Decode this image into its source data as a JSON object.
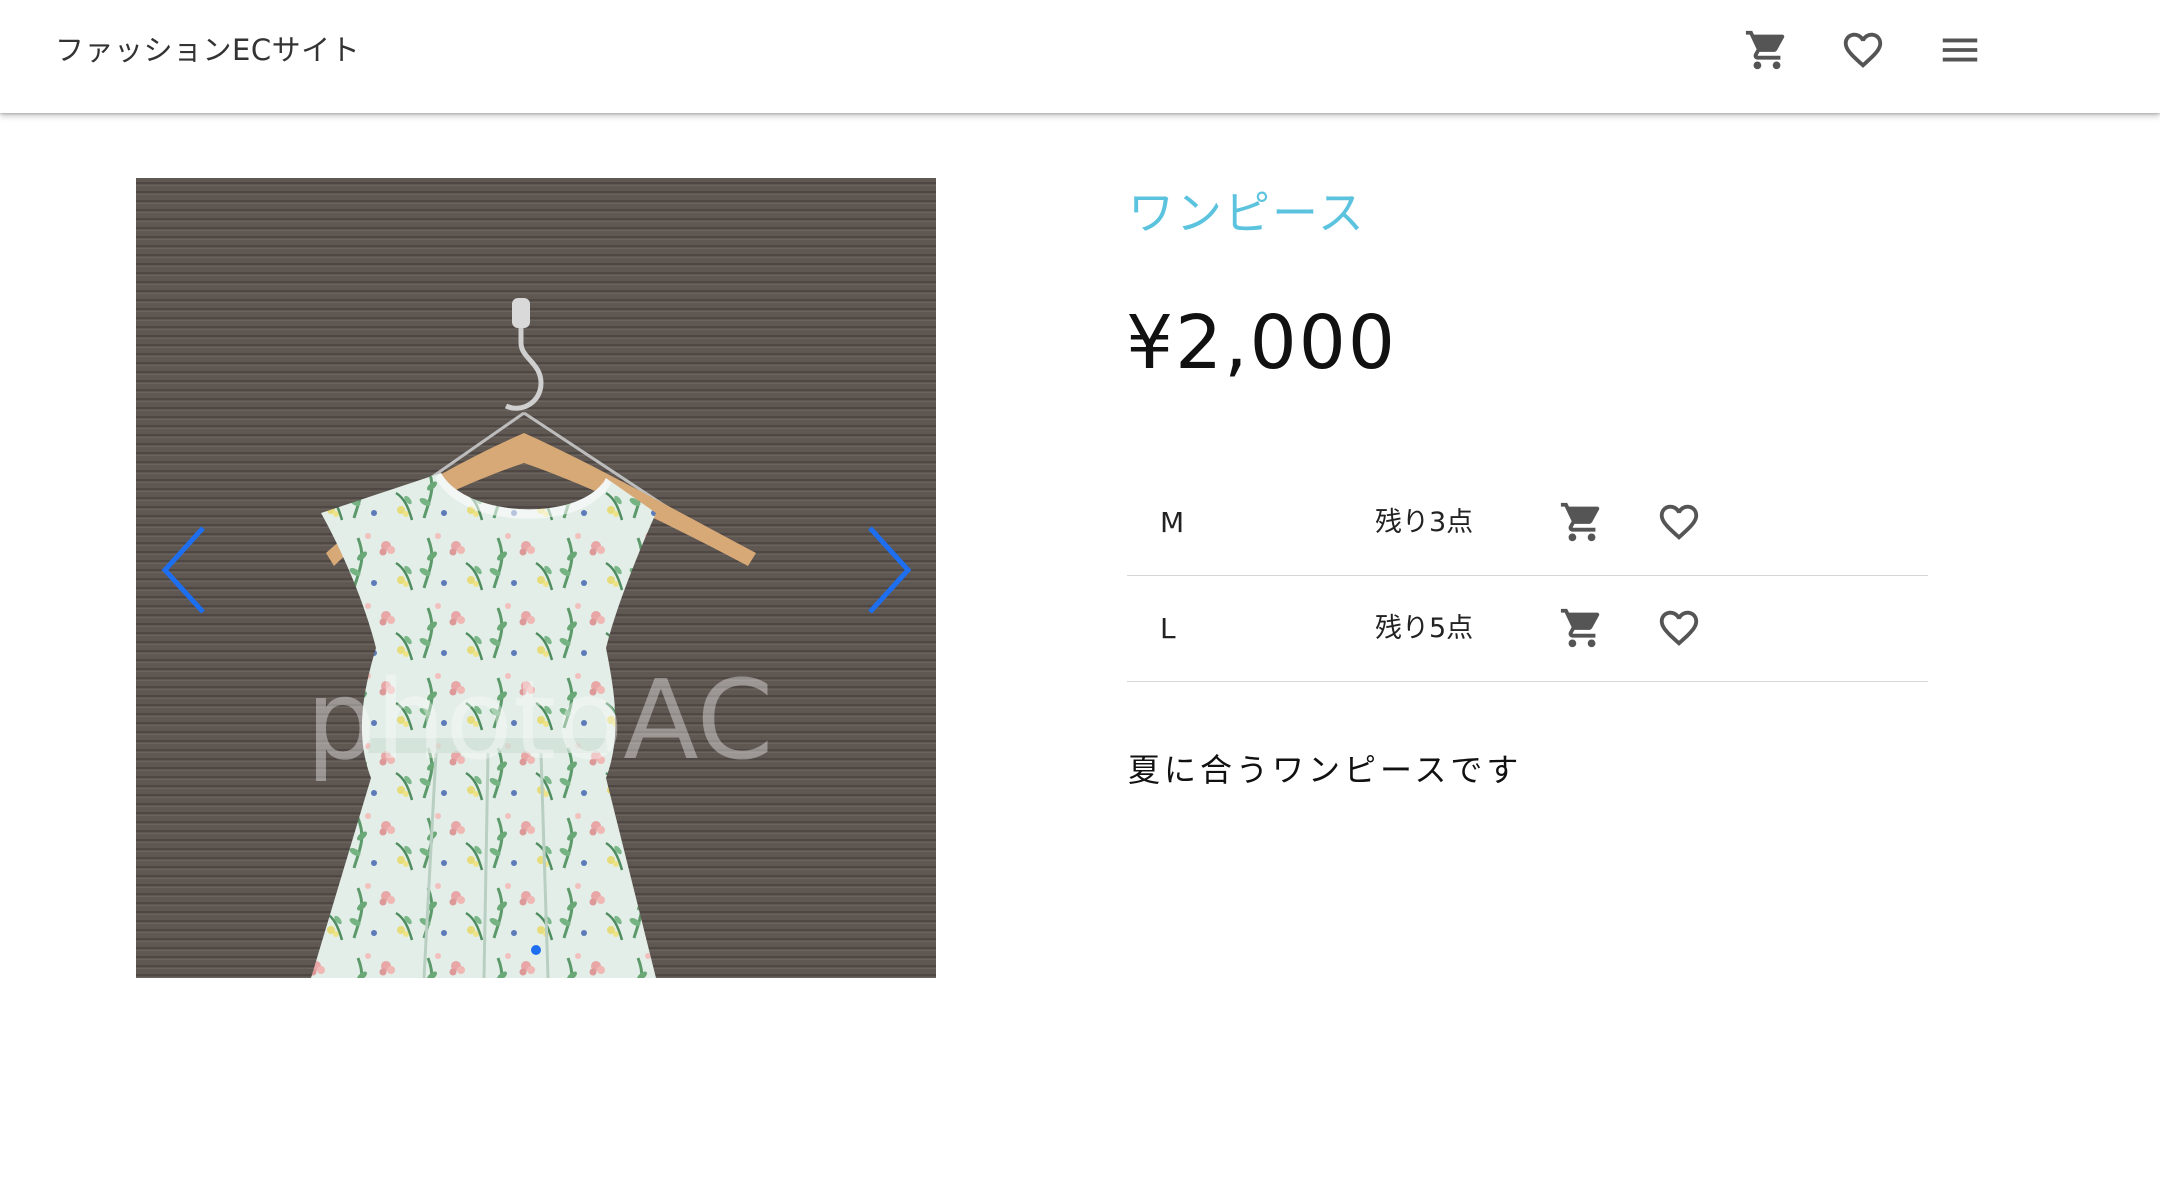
{
  "header": {
    "brand": "ファッションECサイト",
    "icons": [
      "cart-icon",
      "favorite-icon",
      "menu-icon"
    ]
  },
  "carousel": {
    "image_alt": "floral sleeveless dress on wooden hanger",
    "watermark": "photoAC",
    "dots_total": 1,
    "active_dot": 1,
    "arrow_color": "#1e6ff0"
  },
  "product": {
    "name": "ワンピース",
    "price": "¥2,000",
    "description": "夏に合うワンピースです",
    "title_color": "#5cc3df"
  },
  "stock": [
    {
      "size": "M",
      "remaining": "残り3点"
    },
    {
      "size": "L",
      "remaining": "残り5点"
    }
  ]
}
